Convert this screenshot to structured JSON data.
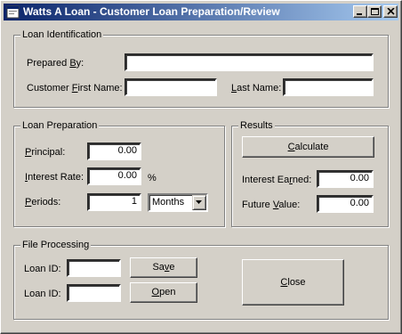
{
  "window": {
    "title": "Watts A Loan - Customer Loan Preparation/Review",
    "minimize_icon": "minimize-icon",
    "maximize_icon": "maximize-icon",
    "close_icon": "close-icon"
  },
  "loan_identification": {
    "legend": "Loan Identification",
    "prepared_by_label_pre": "Prepared ",
    "prepared_by_label_u": "B",
    "prepared_by_label_post": "y:",
    "prepared_by_value": "",
    "first_name_label_pre": "Customer ",
    "first_name_label_u": "F",
    "first_name_label_post": "irst Name:",
    "first_name_value": "",
    "last_name_label_u": "L",
    "last_name_label_post": "ast Name:",
    "last_name_value": ""
  },
  "loan_preparation": {
    "legend": "Loan Preparation",
    "principal_label_u": "P",
    "principal_label_post": "rincipal:",
    "principal_value": "0.00",
    "interest_label_u": "I",
    "interest_label_post": "nterest Rate:",
    "interest_value": "0.00",
    "percent_sign": "%",
    "periods_label_u": "P",
    "periods_label_post": "eriods:",
    "periods_value": "1",
    "period_unit": "Months"
  },
  "results": {
    "legend": "Results",
    "calculate_label_u": "C",
    "calculate_label_post": "alculate",
    "interest_earned_label_pre": "Interest Ea",
    "interest_earned_label_u": "r",
    "interest_earned_label_post": "ned:",
    "interest_earned_value": "0.00",
    "future_value_label_pre": "Future ",
    "future_value_label_u": "V",
    "future_value_label_post": "alue:",
    "future_value_value": "0.00"
  },
  "file_processing": {
    "legend": "File Processing",
    "loan_id_label_1": "Loan ID:",
    "loan_id_value_1": "",
    "save_label_pre": "Sa",
    "save_label_u": "v",
    "save_label_post": "e",
    "loan_id_label_2": "Loan ID:",
    "loan_id_value_2": "",
    "open_label_u": "O",
    "open_label_post": "pen",
    "close_label_u": "C",
    "close_label_post": "lose"
  }
}
